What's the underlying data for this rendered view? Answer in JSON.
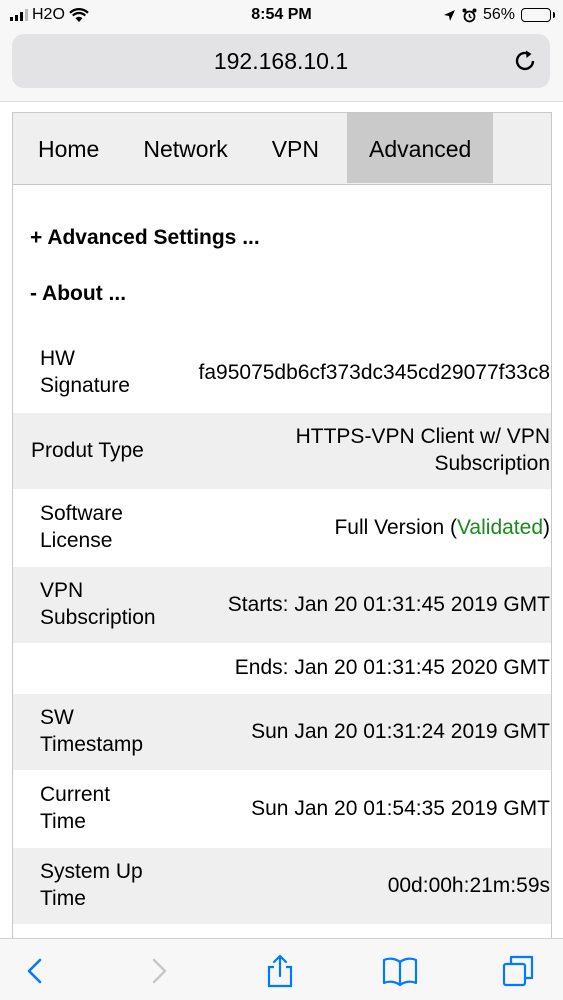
{
  "status_bar": {
    "carrier": "H2O",
    "time": "8:54 PM",
    "battery": "56%",
    "battery_level": 0.56
  },
  "browser": {
    "url": "192.168.10.1",
    "accent_color": "#007aff"
  },
  "nav": {
    "tabs": [
      {
        "label": "Home",
        "active": false
      },
      {
        "label": "Network",
        "active": false
      },
      {
        "label": "VPN",
        "active": false
      },
      {
        "label": "Advanced",
        "active": true
      }
    ]
  },
  "sections": {
    "advanced_settings": "+ Advanced Settings ...",
    "about": "- About ..."
  },
  "about_rows": [
    {
      "label": "HW Signature",
      "value": "fa95075db6cf373dc345cd29077f33c8"
    },
    {
      "label": "Produt Type",
      "value_line1": "HTTPS-VPN Client w/ VPN",
      "value_line2": "Subscription"
    },
    {
      "label": "Software License",
      "value_prefix": "Full Version (",
      "value_status": "Validated",
      "value_suffix": ")",
      "status_color": "#1a8a1a"
    },
    {
      "label": "VPN Subscription",
      "value": "Starts: Jan 20 01:31:45 2019 GMT"
    },
    {
      "label": "",
      "value": "Ends: Jan 20 01:31:45 2020 GMT"
    },
    {
      "label": "SW Timestamp",
      "value": "Sun Jan 20 01:31:24 2019 GMT"
    },
    {
      "label": "Current Time",
      "value": "Sun Jan 20 01:54:35 2019 GMT"
    },
    {
      "label": "System Up Time",
      "value": "00d:00h:21m:59s"
    }
  ],
  "toolbar": {
    "icons": [
      "back-icon",
      "forward-icon",
      "share-icon",
      "bookmarks-icon",
      "tabs-icon"
    ]
  }
}
